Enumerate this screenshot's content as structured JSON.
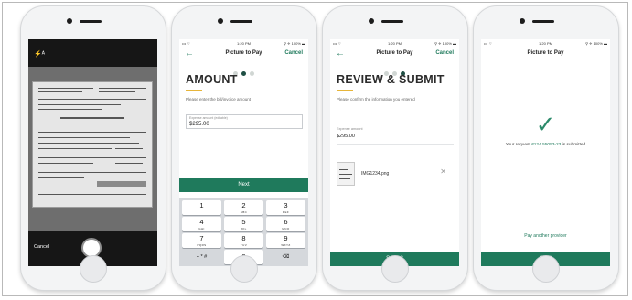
{
  "screens": {
    "camera": {
      "flash_icon": "⚡ᴬ",
      "cancel_label": "Cancel"
    },
    "amount": {
      "status": {
        "left": "••• ⌔",
        "time": "1:20 PM",
        "right": "⚲ ✈ 100% ▬"
      },
      "nav": {
        "title": "Picture to Pay",
        "cancel_label": "Cancel"
      },
      "heading": "AMOUNT",
      "subtitle": "Please enter the bill/invoice amount",
      "field": {
        "label": "Expense amount (editable)",
        "value": "$295.00"
      },
      "next_label": "Next",
      "keys": [
        {
          "n": "1",
          "s": ""
        },
        {
          "n": "2",
          "s": "ABC"
        },
        {
          "n": "3",
          "s": "DEF"
        },
        {
          "n": "4",
          "s": "GHI"
        },
        {
          "n": "5",
          "s": "JKL"
        },
        {
          "n": "6",
          "s": "MNO"
        },
        {
          "n": "7",
          "s": "PQRS"
        },
        {
          "n": "8",
          "s": "TUV"
        },
        {
          "n": "9",
          "s": "WXYZ"
        }
      ],
      "key_symbols": "+ * #",
      "key_zero": "0",
      "key_delete": "⌫"
    },
    "review": {
      "status": {
        "left": "••• ⌔",
        "time": "1:20 PM",
        "right": "⚲ ✈ 100% ▬"
      },
      "nav": {
        "title": "Picture to Pay",
        "cancel_label": "Cancel"
      },
      "heading": "REVIEW & SUBMIT",
      "subtitle": "Please confirm the information you entered",
      "expense_label": "Expense amount",
      "expense_value": "$295.00",
      "filename": "IMG1234.png",
      "remove_icon": "✕",
      "submit_label": "Submit"
    },
    "confirmation": {
      "status": {
        "left": "••• ⌔",
        "time": "1:20 PM",
        "right": "⚲ ✈ 100% ▬"
      },
      "nav": {
        "title": "Picture to Pay"
      },
      "check_icon": "✓",
      "message_prefix": "Your request ",
      "request_id": "#124 55053-23",
      "message_suffix": " is submitted",
      "pay_another_label": "Pay another provider",
      "got_it_label": "Got it"
    }
  },
  "colors": {
    "accent": "#1f7a5c",
    "underline": "#e7b53a"
  }
}
